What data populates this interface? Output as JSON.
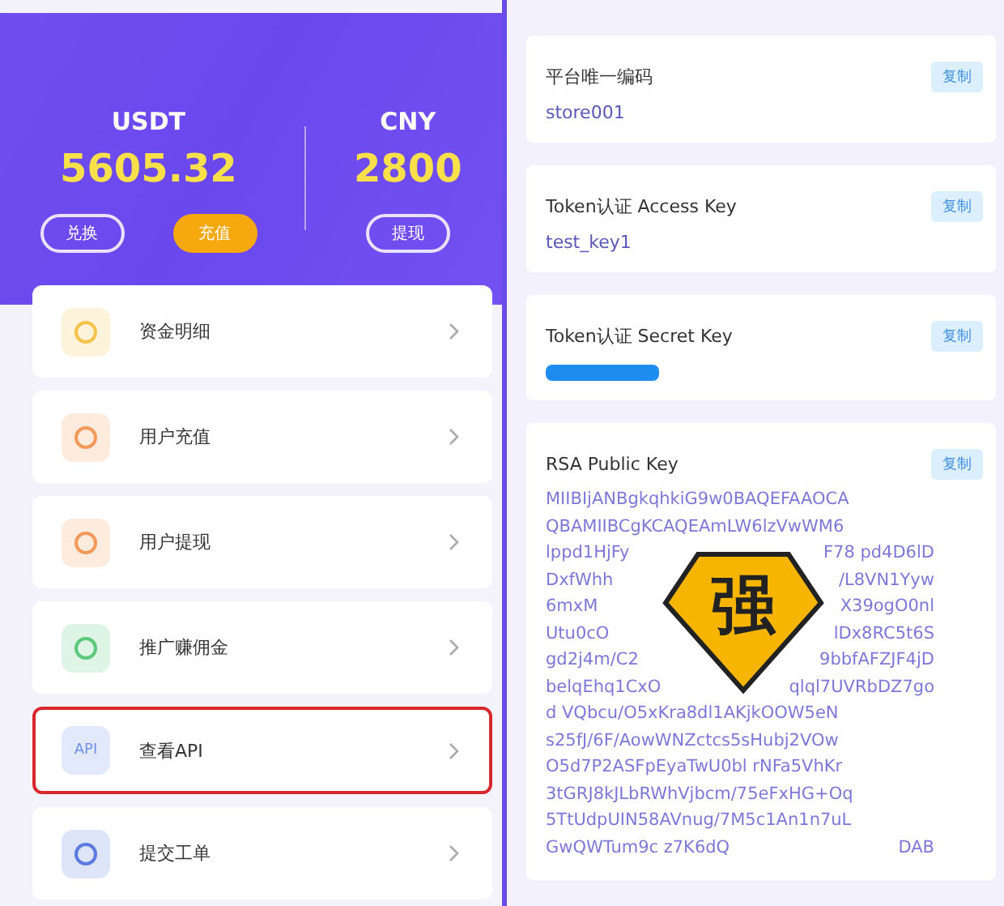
{
  "balances": [
    {
      "currency": "USDT",
      "amount": "5605.32",
      "buttons": [
        {
          "label": "兑换",
          "kind": "outline"
        },
        {
          "label": "充值",
          "kind": "filled"
        }
      ]
    },
    {
      "currency": "CNY",
      "amount": "2800",
      "buttons": [
        {
          "label": "提现",
          "kind": "outline"
        }
      ]
    }
  ],
  "menu": [
    {
      "label": "资金明细",
      "color": "#f6c34a",
      "selected": false
    },
    {
      "label": "用户充值",
      "color": "#f39a5a",
      "selected": false
    },
    {
      "label": "用户提现",
      "color": "#f39a5a",
      "selected": false
    },
    {
      "label": "推广赚佣金",
      "color": "#5cc97a",
      "selected": false
    },
    {
      "label": "查看API",
      "color": "#6f8fe8",
      "icon_text": "API",
      "selected": true
    },
    {
      "label": "提交工单",
      "color": "#5b7be0",
      "selected": false
    }
  ],
  "fields": [
    {
      "label": "平台唯一编码",
      "value": "store001",
      "copy": "复制"
    },
    {
      "label": "Token认证 Access Key",
      "value": "test_key1",
      "copy": "复制"
    },
    {
      "label": "Token认证 Secret Key",
      "masked": true,
      "copy": "复制"
    },
    {
      "label": "RSA Public Key",
      "copy": "复制",
      "lines": [
        {
          "left": "MIIBIjANBgkqhkiG9w0BAQEFAAOCA"
        },
        {
          "left": "QBAMIIBCgKCAQEAmLW6lzVwWM6"
        },
        {
          "left": "lppd1HjFy",
          "right": "F78 pd4D6lD"
        },
        {
          "left": "DxfWhh",
          "right": "/L8VN1Yyw"
        },
        {
          "left": "6mxM",
          "right": "X39ogO0nl"
        },
        {
          "left": "Utu0cO",
          "right": "lDx8RC5t6S"
        },
        {
          "left": "gd2j4m/C2",
          "right": "9bbfAFZJF4jD"
        },
        {
          "left": "belqEhq1CxO",
          "right": "qlql7UVRbDZ7go"
        },
        {
          "left": "d VQbcu/O5xKra8dl1AKjkOOW5eN"
        },
        {
          "left": "s25fJ/6F/AowWNZctcs5sHubj2VOw"
        },
        {
          "left": "O5d7P2ASFpEyaTwU0bl rNFa5VhKr"
        },
        {
          "left": "3tGRJ8kJLbRWhVjbcm/75eFxHG+Oq"
        },
        {
          "left": "5TtUdpUIN58AVnug/7M5c1An1n7uL"
        },
        {
          "left": "GwQWTum9c z7K6dQ",
          "right": "DAB"
        }
      ],
      "sticker": "强"
    }
  ]
}
